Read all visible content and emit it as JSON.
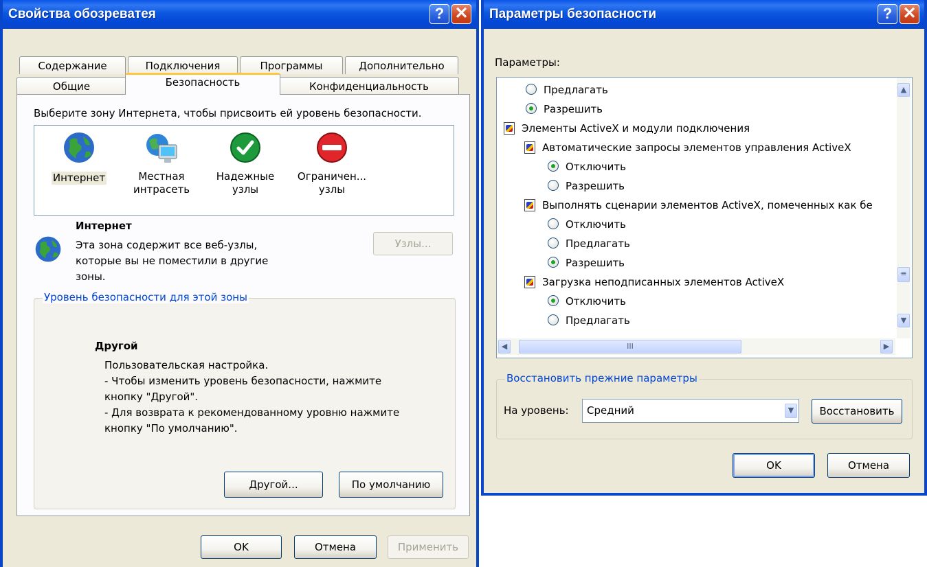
{
  "left_window": {
    "title": "Свойства обозреватея",
    "help_glyph": "?",
    "close_glyph": "✕",
    "tabs_row1": [
      "Содержание",
      "Подключения",
      "Программы",
      "Дополнительно"
    ],
    "tabs_row2": [
      "Общие",
      "Безопасность",
      "Конфиденциальность"
    ],
    "active_tab": "Безопасность",
    "instruction": "Выберите зону Интернета, чтобы присвоить ей уровень безопасности.",
    "zones": [
      {
        "name": "Интернет",
        "icon": "globe-icon",
        "selected": true
      },
      {
        "name": "Местная интрасеть",
        "line1": "Местная",
        "line2": "интрасеть",
        "icon": "intranet-computer-icon"
      },
      {
        "name": "Надежные узлы",
        "line1": "Надежные",
        "line2": "узлы",
        "icon": "trusted-check-icon"
      },
      {
        "name": "Ограничен... узлы",
        "line1": "Ограничен...",
        "line2": "узлы",
        "icon": "restricted-no-entry-icon"
      }
    ],
    "zone_info": {
      "title": "Интернет",
      "line1": "Эта зона содержит все веб-узлы,",
      "line2": "которые вы не поместили в другие",
      "line3": "зоны.",
      "sites_button": "Узлы..."
    },
    "security_level": {
      "group_title": "Уровень безопасности для этой зоны",
      "level_name": "Другой",
      "line1": "Пользовательская настройка.",
      "line2": "- Чтобы изменить уровень безопасности, нажмите",
      "line3": "кнопку \"Другой\".",
      "line4": "- Для возврата к рекомендованному уровню нажмите",
      "line5": "кнопку \"По умолчанию\".",
      "custom_button": "Другой...",
      "default_button": "По умолчанию"
    },
    "footer": {
      "ok": "OK",
      "cancel": "Отмена",
      "apply": "Применить"
    }
  },
  "right_window": {
    "title": "Параметры безопасности",
    "help_glyph": "?",
    "close_glyph": "✕",
    "settings_label": "Параметры:",
    "tree": [
      {
        "type": "radio",
        "label": "Предлагать",
        "checked": false,
        "indent": 1
      },
      {
        "type": "radio",
        "label": "Разрешить",
        "checked": true,
        "indent": 1
      },
      {
        "type": "category",
        "label": "Элементы ActiveX и модули подключения",
        "indent": 0
      },
      {
        "type": "setting",
        "label": "Автоматические запросы элементов управления ActiveX",
        "indent": 1
      },
      {
        "type": "radio",
        "label": "Отключить",
        "checked": true,
        "indent": 2
      },
      {
        "type": "radio",
        "label": "Разрешить",
        "checked": false,
        "indent": 2
      },
      {
        "type": "setting",
        "label": "Выполнять сценарии элементов ActiveX, помеченных как бе",
        "indent": 1
      },
      {
        "type": "radio",
        "label": "Отключить",
        "checked": false,
        "indent": 2
      },
      {
        "type": "radio",
        "label": "Предлагать",
        "checked": false,
        "indent": 2
      },
      {
        "type": "radio",
        "label": "Разрешить",
        "checked": true,
        "indent": 2
      },
      {
        "type": "setting",
        "label": "Загрузка неподписанных элементов ActiveX",
        "indent": 1
      },
      {
        "type": "radio",
        "label": "Отключить",
        "checked": true,
        "indent": 2
      },
      {
        "type": "radio",
        "label": "Предлагать",
        "checked": false,
        "indent": 2
      }
    ],
    "scroll": {
      "up": "▲",
      "down": "▼",
      "left": "◀",
      "right": "▶",
      "grip": "≡",
      "hgrip": "III"
    },
    "reset": {
      "group_title": "Восстановить прежние параметры",
      "level_label": "На уровень:",
      "level_value": "Средний",
      "reset_button": "Восстановить"
    },
    "footer": {
      "ok": "OK",
      "cancel": "Отмена"
    }
  }
}
